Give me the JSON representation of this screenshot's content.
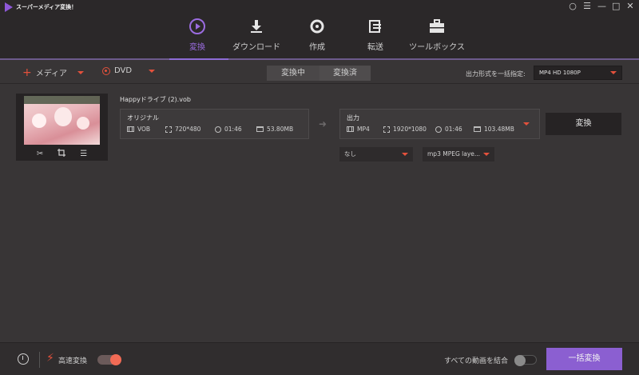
{
  "app": {
    "title": "スーパーメディア変換！",
    "window_controls": [
      "user",
      "menu",
      "minimize",
      "maximize",
      "close"
    ]
  },
  "nav": {
    "items": [
      {
        "label": "変換",
        "icon": "convert-play-icon",
        "active": true
      },
      {
        "label": "ダウンロード",
        "icon": "download-icon",
        "active": false
      },
      {
        "label": "作成",
        "icon": "disc-icon",
        "active": false
      },
      {
        "label": "転送",
        "icon": "transfer-icon",
        "active": false
      },
      {
        "label": "ツールボックス",
        "icon": "toolbox-icon",
        "active": false
      }
    ],
    "accent": "#9b6ce0"
  },
  "toolbar": {
    "add_media_label": "メディア",
    "dvd_label": "DVD",
    "tab_converting": "変換中",
    "tab_converted": "変換済",
    "format_label": "出力形式を一括指定:",
    "format_value": "MP4 HD 1080P"
  },
  "file": {
    "name": "Happyドライブ (2).vob",
    "source": {
      "title": "オリジナル",
      "format": "VOB",
      "resolution": "720*480",
      "duration": "01:46",
      "size": "53.80MB"
    },
    "output": {
      "title": "出力",
      "format": "MP4",
      "resolution": "1920*1080",
      "duration": "01:46",
      "size": "103.48MB"
    },
    "subtitle_value": "なし",
    "audio_value": "mp3 MPEG laye...",
    "convert_label": "変換"
  },
  "bottom": {
    "high_speed_label": "高速変換",
    "high_speed_on": true,
    "merge_label": "すべての動画を結合",
    "merge_on": false,
    "batch_convert_label": "一括変換"
  }
}
